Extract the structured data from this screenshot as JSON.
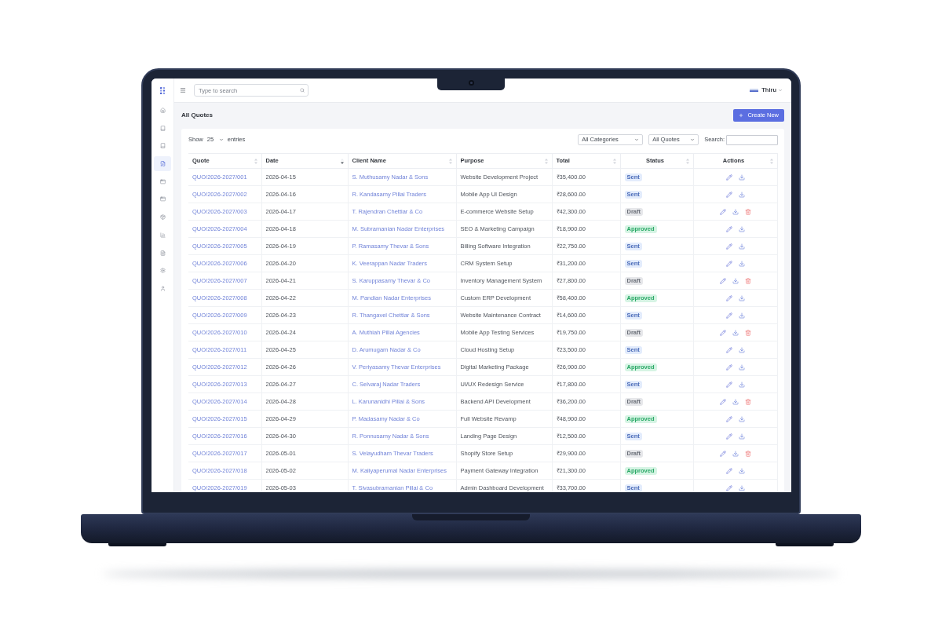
{
  "sidebar": {
    "items": [
      {
        "selected": false
      },
      {
        "selected": false
      },
      {
        "selected": false
      },
      {
        "selected": true
      },
      {
        "selected": false
      },
      {
        "selected": false
      },
      {
        "selected": false
      },
      {
        "selected": false
      },
      {
        "selected": false
      },
      {
        "selected": false
      },
      {
        "selected": false
      }
    ]
  },
  "top_bar": {
    "search": {
      "placeholder": "Type to search"
    },
    "user": {
      "name": "Thiru"
    }
  },
  "page": {
    "title": "All Quotes",
    "create_button": "Create New"
  },
  "table_controls": {
    "show_label": "Show",
    "page_size": "25",
    "entries_label": "entries",
    "filters": [
      {
        "value": "All Categories"
      },
      {
        "value": "All Quotes"
      }
    ],
    "search_label": "Search:"
  },
  "table": {
    "columns": [
      {
        "label": "Quote",
        "sorted": false
      },
      {
        "label": "Date",
        "sorted": true
      },
      {
        "label": "Client Name",
        "sorted": false
      },
      {
        "label": "Purpose",
        "sorted": false
      },
      {
        "label": "Total",
        "sorted": false
      },
      {
        "label": "Status",
        "sorted": false
      },
      {
        "label": "Actions",
        "sorted": false
      }
    ],
    "rows": [
      {
        "quote": "QUO/2026-2027/001",
        "date": "2026-04-15",
        "client": "S. Muthusamy Nadar & Sons",
        "purpose": "Website Development Project",
        "total": "₹35,400.00",
        "status": {
          "label": "Sent",
          "kind": "sent"
        },
        "actions": [
          {
            "kind": "edit"
          },
          {
            "kind": "download"
          }
        ]
      },
      {
        "quote": "QUO/2026-2027/002",
        "date": "2026-04-16",
        "client": "R. Kandasamy Pillai Traders",
        "purpose": "Mobile App UI Design",
        "total": "₹28,600.00",
        "status": {
          "label": "Sent",
          "kind": "sent"
        },
        "actions": [
          {
            "kind": "edit"
          },
          {
            "kind": "download"
          }
        ]
      },
      {
        "quote": "QUO/2026-2027/003",
        "date": "2026-04-17",
        "client": "T. Rajendran Chettiar & Co",
        "purpose": "E-commerce Website Setup",
        "total": "₹42,300.00",
        "status": {
          "label": "Draft",
          "kind": "draft"
        },
        "actions": [
          {
            "kind": "edit"
          },
          {
            "kind": "download"
          },
          {
            "kind": "delete"
          }
        ]
      },
      {
        "quote": "QUO/2026-2027/004",
        "date": "2026-04-18",
        "client": "M. Subramanian Nadar Enterprises",
        "purpose": "SEO & Marketing Campaign",
        "total": "₹18,900.00",
        "status": {
          "label": "Approved",
          "kind": "approved"
        },
        "actions": [
          {
            "kind": "edit"
          },
          {
            "kind": "download"
          }
        ]
      },
      {
        "quote": "QUO/2026-2027/005",
        "date": "2026-04-19",
        "client": "P. Ramasamy Thevar & Sons",
        "purpose": "Billing Software Integration",
        "total": "₹22,750.00",
        "status": {
          "label": "Sent",
          "kind": "sent"
        },
        "actions": [
          {
            "kind": "edit"
          },
          {
            "kind": "download"
          }
        ]
      },
      {
        "quote": "QUO/2026-2027/006",
        "date": "2026-04-20",
        "client": "K. Veerappan Nadar Traders",
        "purpose": "CRM System Setup",
        "total": "₹31,200.00",
        "status": {
          "label": "Sent",
          "kind": "sent"
        },
        "actions": [
          {
            "kind": "edit"
          },
          {
            "kind": "download"
          }
        ]
      },
      {
        "quote": "QUO/2026-2027/007",
        "date": "2026-04-21",
        "client": "S. Karuppasamy Thevar & Co",
        "purpose": "Inventory Management System",
        "total": "₹27,800.00",
        "status": {
          "label": "Draft",
          "kind": "draft"
        },
        "actions": [
          {
            "kind": "edit"
          },
          {
            "kind": "download"
          },
          {
            "kind": "delete"
          }
        ]
      },
      {
        "quote": "QUO/2026-2027/008",
        "date": "2026-04-22",
        "client": "M. Pandian Nadar Enterprises",
        "purpose": "Custom ERP Development",
        "total": "₹58,400.00",
        "status": {
          "label": "Approved",
          "kind": "approved"
        },
        "actions": [
          {
            "kind": "edit"
          },
          {
            "kind": "download"
          }
        ]
      },
      {
        "quote": "QUO/2026-2027/009",
        "date": "2026-04-23",
        "client": "R. Thangavel Chettiar & Sons",
        "purpose": "Website Maintenance Contract",
        "total": "₹14,600.00",
        "status": {
          "label": "Sent",
          "kind": "sent"
        },
        "actions": [
          {
            "kind": "edit"
          },
          {
            "kind": "download"
          }
        ]
      },
      {
        "quote": "QUO/2026-2027/010",
        "date": "2026-04-24",
        "client": "A. Muthiah Pillai Agencies",
        "purpose": "Mobile App Testing Services",
        "total": "₹19,750.00",
        "status": {
          "label": "Draft",
          "kind": "draft"
        },
        "actions": [
          {
            "kind": "edit"
          },
          {
            "kind": "download"
          },
          {
            "kind": "delete"
          }
        ]
      },
      {
        "quote": "QUO/2026-2027/011",
        "date": "2026-04-25",
        "client": "D. Arumugam Nadar & Co",
        "purpose": "Cloud Hosting Setup",
        "total": "₹23,500.00",
        "status": {
          "label": "Sent",
          "kind": "sent"
        },
        "actions": [
          {
            "kind": "edit"
          },
          {
            "kind": "download"
          }
        ]
      },
      {
        "quote": "QUO/2026-2027/012",
        "date": "2026-04-26",
        "client": "V. Periyasamy Thevar Enterprises",
        "purpose": "Digital Marketing Package",
        "total": "₹26,900.00",
        "status": {
          "label": "Approved",
          "kind": "approved"
        },
        "actions": [
          {
            "kind": "edit"
          },
          {
            "kind": "download"
          }
        ]
      },
      {
        "quote": "QUO/2026-2027/013",
        "date": "2026-04-27",
        "client": "C. Selvaraj Nadar Traders",
        "purpose": "UI/UX Redesign Service",
        "total": "₹17,800.00",
        "status": {
          "label": "Sent",
          "kind": "sent"
        },
        "actions": [
          {
            "kind": "edit"
          },
          {
            "kind": "download"
          }
        ]
      },
      {
        "quote": "QUO/2026-2027/014",
        "date": "2026-04-28",
        "client": "L. Karunanidhi Pillai & Sons",
        "purpose": "Backend API Development",
        "total": "₹36,200.00",
        "status": {
          "label": "Draft",
          "kind": "draft"
        },
        "actions": [
          {
            "kind": "edit"
          },
          {
            "kind": "download"
          },
          {
            "kind": "delete"
          }
        ]
      },
      {
        "quote": "QUO/2026-2027/015",
        "date": "2026-04-29",
        "client": "P. Madasamy Nadar & Co",
        "purpose": "Full Website Revamp",
        "total": "₹48,900.00",
        "status": {
          "label": "Approved",
          "kind": "approved"
        },
        "actions": [
          {
            "kind": "edit"
          },
          {
            "kind": "download"
          }
        ]
      },
      {
        "quote": "QUO/2026-2027/016",
        "date": "2026-04-30",
        "client": "R. Ponnusamy Nadar & Sons",
        "purpose": "Landing Page Design",
        "total": "₹12,500.00",
        "status": {
          "label": "Sent",
          "kind": "sent"
        },
        "actions": [
          {
            "kind": "edit"
          },
          {
            "kind": "download"
          }
        ]
      },
      {
        "quote": "QUO/2026-2027/017",
        "date": "2026-05-01",
        "client": "S. Velayudham Thevar Traders",
        "purpose": "Shopify Store Setup",
        "total": "₹29,900.00",
        "status": {
          "label": "Draft",
          "kind": "draft"
        },
        "actions": [
          {
            "kind": "edit"
          },
          {
            "kind": "download"
          },
          {
            "kind": "delete"
          }
        ]
      },
      {
        "quote": "QUO/2026-2027/018",
        "date": "2026-05-02",
        "client": "M. Kaliyaperumal Nadar Enterprises",
        "purpose": "Payment Gateway Integration",
        "total": "₹21,300.00",
        "status": {
          "label": "Approved",
          "kind": "approved"
        },
        "actions": [
          {
            "kind": "edit"
          },
          {
            "kind": "download"
          }
        ]
      },
      {
        "quote": "QUO/2026-2027/019",
        "date": "2026-05-03",
        "client": "T. Sivasubramanian Pillai & Co",
        "purpose": "Admin Dashboard Development",
        "total": "₹33,700.00",
        "status": {
          "label": "Sent",
          "kind": "sent"
        },
        "actions": [
          {
            "kind": "edit"
          },
          {
            "kind": "download"
          }
        ]
      }
    ]
  }
}
